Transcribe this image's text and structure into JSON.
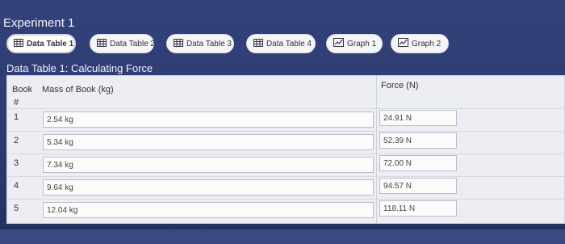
{
  "experiment": {
    "title": "Experiment 1"
  },
  "tabs": [
    {
      "label": "Data Table 1",
      "icon": "table-icon",
      "active": true
    },
    {
      "label": "Data Table 2",
      "icon": "table-icon",
      "active": false
    },
    {
      "label": "Data Table 3",
      "icon": "table-icon",
      "active": false
    },
    {
      "label": "Data Table 4",
      "icon": "table-icon",
      "active": false
    },
    {
      "label": "Graph 1",
      "icon": "graph-icon",
      "active": false
    },
    {
      "label": "Graph 2",
      "icon": "graph-icon",
      "active": false
    }
  ],
  "table": {
    "title": "Data Table 1: Calculating Force",
    "headers": {
      "book": "Book",
      "book_num": "#",
      "mass": "Mass of Book (kg)",
      "force": "Force (N)"
    },
    "rows": [
      {
        "num": "1",
        "mass": "2.54 kg",
        "force": "24.91 N"
      },
      {
        "num": "2",
        "mass": "5.34 kg",
        "force": "52.39 N"
      },
      {
        "num": "3",
        "mass": "7.34 kg",
        "force": "72.00 N"
      },
      {
        "num": "4",
        "mass": "9.64 kg",
        "force": "94.57 N"
      },
      {
        "num": "5",
        "mass": "12.04 kg",
        "force": "118.11 N"
      }
    ]
  },
  "colors": {
    "background": "#2b3a70",
    "tab_bg": "#f4f5f8",
    "table_bg": "#eceef3"
  }
}
